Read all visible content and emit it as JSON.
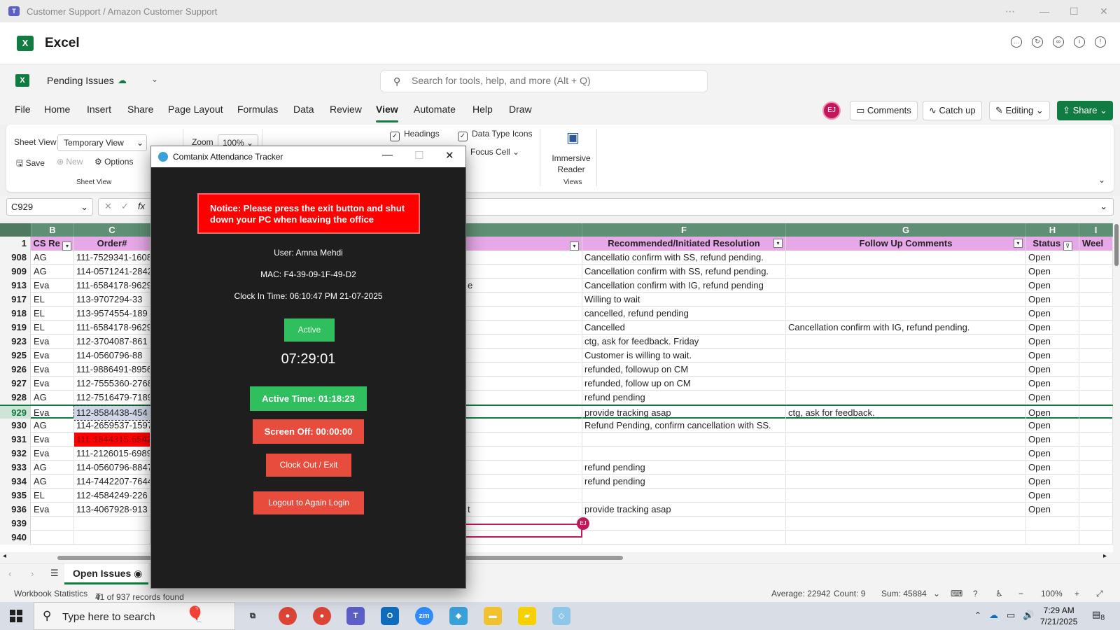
{
  "window": {
    "title": "Customer Support / Amazon Customer Support"
  },
  "excel": {
    "app_name": "Excel",
    "file_name": "Pending Issues",
    "search_placeholder": "Search for tools, help, and more (Alt + Q)",
    "menu": [
      "File",
      "Home",
      "Insert",
      "Share",
      "Page Layout",
      "Formulas",
      "Data",
      "Review",
      "View",
      "Automate",
      "Help",
      "Draw"
    ],
    "active_menu": "View",
    "avatar": "EJ",
    "comments_label": "Comments",
    "catchup_label": "Catch up",
    "editing_label": "Editing",
    "share_label": "Share"
  },
  "ribbon": {
    "sheet_view_label": "Sheet View",
    "sheet_view_value": "Temporary View",
    "save": "Save",
    "new": "New",
    "options": "Options",
    "group_sheet_view": "Sheet View",
    "zoom_label": "Zoom",
    "zoom_value": "100%",
    "headings": "Headings",
    "data_type_icons": "Data Type Icons",
    "focus_cell": "Focus Cell",
    "immersive_reader_1": "Immersive",
    "immersive_reader_2": "Reader",
    "group_views": "Views"
  },
  "formula_bar": {
    "name_box": "C929",
    "fx": "fx"
  },
  "grid": {
    "columns": [
      "B",
      "C",
      "F",
      "G",
      "H",
      "I"
    ],
    "header_row_num": "1",
    "headers": {
      "b": "CS Re",
      "c": "Order#",
      "f": "Recommended/Initiated Resolution",
      "g": "Follow Up Comments",
      "h": "Status",
      "i": "Weel"
    },
    "rows": [
      {
        "n": "908",
        "b": "AG",
        "c": "111-7529341-1608",
        "e": "",
        "f": "Cancellatio confirm with SS, refund pending.",
        "g": "",
        "h": "Open"
      },
      {
        "n": "909",
        "b": "AG",
        "c": "114-0571241-2842",
        "e": "",
        "f": "Cancellation confirm with SS, refund pending.",
        "g": "",
        "h": "Open"
      },
      {
        "n": "913",
        "b": "Eva",
        "c": "111-6584178-9629",
        "e": "e",
        "f": "Cancellation confirm with IG, refund pending",
        "g": "",
        "h": "Open"
      },
      {
        "n": "917",
        "b": "EL",
        "c": "113-9707294-33",
        "e": "",
        "f": "Willing to wait",
        "g": "",
        "h": "Open"
      },
      {
        "n": "918",
        "b": "EL",
        "c": "113-9574554-189",
        "e": "",
        "f": "cancelled, refund pending",
        "g": "",
        "h": "Open"
      },
      {
        "n": "919",
        "b": "EL",
        "c": "111-6584178-9629",
        "e": "",
        "f": "Cancelled",
        "g": "Cancellation confirm with IG, refund pending.",
        "h": "Open"
      },
      {
        "n": "923",
        "b": "Eva",
        "c": "112-3704087-861",
        "e": "",
        "f": "ctg, ask for feedback. Friday",
        "g": "",
        "h": "Open"
      },
      {
        "n": "925",
        "b": "Eva",
        "c": "114-0560796-88",
        "e": "",
        "f": "Customer is willing to wait.",
        "g": "",
        "h": "Open"
      },
      {
        "n": "926",
        "b": "Eva",
        "c": "111-9886491-8956",
        "e": "",
        "f": "refunded, followup on CM",
        "g": "",
        "h": "Open"
      },
      {
        "n": "927",
        "b": "Eva",
        "c": "112-7555360-2768",
        "e": "",
        "f": "refunded, follow up on CM",
        "g": "",
        "h": "Open"
      },
      {
        "n": "928",
        "b": "AG",
        "c": "112-7516479-7189",
        "e": "",
        "f": "refund pending",
        "g": "",
        "h": "Open"
      },
      {
        "n": "929",
        "b": "Eva",
        "c": "112-8584438-454",
        "e": "",
        "f": "provide tracking asap",
        "g": "ctg, ask for feedback.",
        "h": "Open"
      },
      {
        "n": "930",
        "b": "AG",
        "c": "114-2659537-1597",
        "e": "",
        "f": "Refund Pending, confirm cancellation with SS.",
        "g": "",
        "h": "Open"
      },
      {
        "n": "931",
        "b": "Eva",
        "c": "111-1844315-6542",
        "e": "",
        "f": "",
        "g": "",
        "h": "Open"
      },
      {
        "n": "932",
        "b": "Eva",
        "c": "111-2126015-6989",
        "e": "",
        "f": "",
        "g": "",
        "h": "Open"
      },
      {
        "n": "933",
        "b": "AG",
        "c": "114-0560796-8847",
        "e": "",
        "f": "refund pending",
        "g": "",
        "h": "Open"
      },
      {
        "n": "934",
        "b": "AG",
        "c": "114-7442207-7644",
        "e": "",
        "f": "refund pending",
        "g": "",
        "h": "Open"
      },
      {
        "n": "935",
        "b": "EL",
        "c": "112-4584249-226",
        "e": "",
        "f": "",
        "g": "",
        "h": "Open"
      },
      {
        "n": "936",
        "b": "Eva",
        "c": "113-4067928-913",
        "e": "t",
        "f": "provide tracking asap",
        "g": "",
        "h": "Open"
      },
      {
        "n": "939",
        "b": "",
        "c": "",
        "e": "",
        "f": "",
        "g": "",
        "h": ""
      },
      {
        "n": "940",
        "b": "",
        "c": "",
        "e": "",
        "f": "",
        "g": "",
        "h": ""
      }
    ],
    "cursor_avatar": "EJ"
  },
  "sheet_tab": "Open Issues",
  "status_bar": {
    "workbook_statistics": "Workbook Statistics",
    "records": "41 of 937 records found",
    "average": "Average: 22942",
    "count": "Count: 9",
    "sum": "Sum: 45884",
    "zoom": "100%"
  },
  "taskbar": {
    "search_placeholder": "Type here to search",
    "time": "7:29 AM",
    "date": "7/21/2025",
    "notifications": "8"
  },
  "tracker": {
    "title": "Comtanix Attendance Tracker",
    "notice": "Notice: Please press the exit button and shut down your PC when leaving the office",
    "user": "User: Amna Mehdi",
    "mac": "MAC: F4-39-09-1F-49-D2",
    "clock_in": "Clock In Time: 06:10:47 PM 21-07-2025",
    "status": "Active",
    "timer": "07:29:01",
    "active_time": "Active Time: 01:18:23",
    "screen_off": "Screen Off: 00:00:00",
    "clock_out": "Clock Out / Exit",
    "logout": "Logout to Again Login"
  },
  "colors": {
    "excel_green": "#107c41",
    "header_pink": "#e6a8e6",
    "notice_red": "#ff0000",
    "active_green": "#2fbf5e",
    "button_red": "#e74c3c"
  }
}
